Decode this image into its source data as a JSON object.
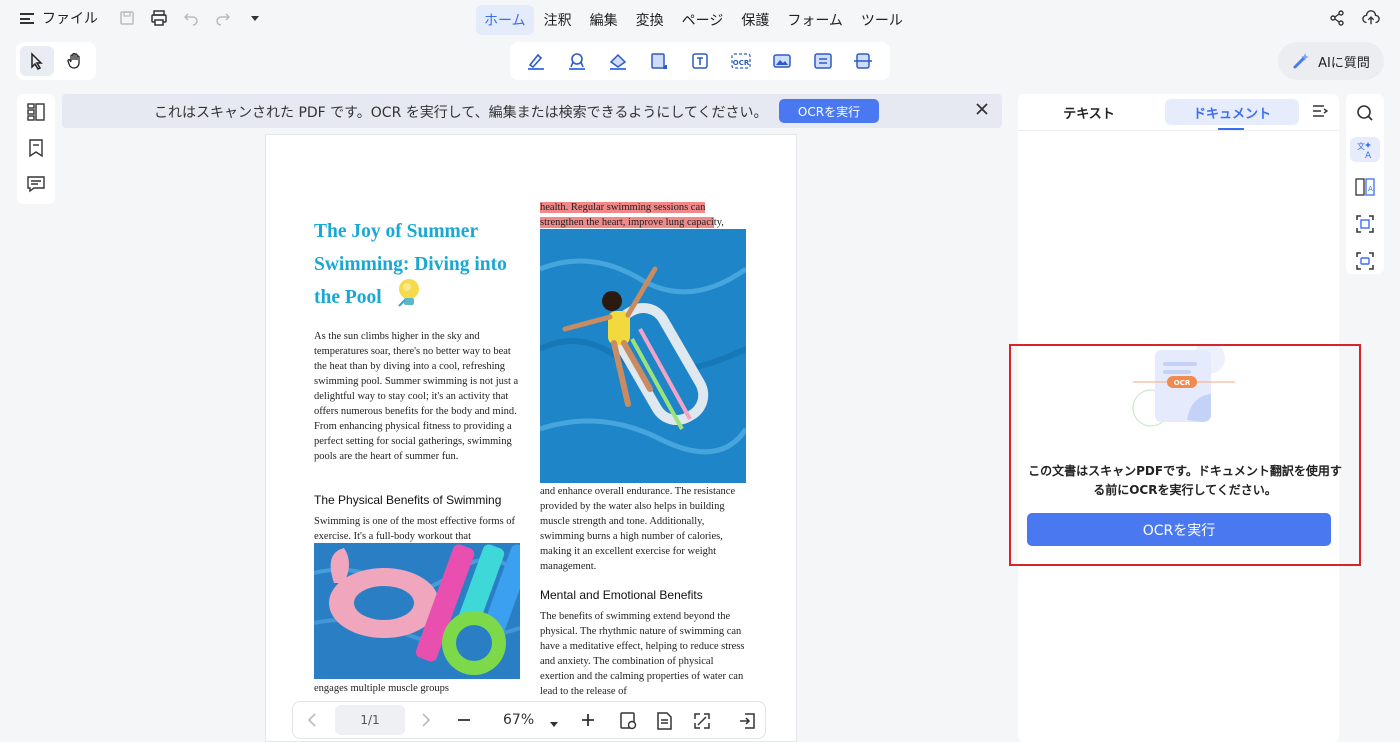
{
  "menu": {
    "file_label": "ファイル",
    "tabs": [
      "ホーム",
      "注釈",
      "編集",
      "変換",
      "ページ",
      "保護",
      "フォーム",
      "ツール"
    ]
  },
  "ai_button": {
    "label": "AIに質問"
  },
  "banner": {
    "text": "これはスキャンされた PDF です。OCR を実行して、編集または検索できるようにしてください。",
    "button_label": "OCRを実行"
  },
  "document": {
    "title": "The Joy of Summer Swimming: Diving into the Pool",
    "intro": "As the sun climbs higher in the sky and temperatures soar, there's no better way to beat the heat than by diving into a cool, refreshing swimming pool. Summer swimming is not just a delightful way to stay cool; it's an activity that offers numerous benefits for the body and mind. From enhancing physical fitness to providing a perfect setting for social gatherings, swimming pools are the heart of summer fun.",
    "section1_heading": "The Physical Benefits of Swimming",
    "section1_text": "Swimming is one of the most effective forms of exercise. It's a full-body workout that",
    "section1_continued": "engages multiple muscle groups",
    "right_highlight_1": "health. Regular swimming sessions can",
    "right_highlight_2": "strengthen the heart, improve lung capaci",
    "right_highlight_2_tail": "ty,",
    "right_continued": "and enhance overall endurance. The resistance provided by the water also helps in building muscle strength and tone. Additionally, swimming burns a high number of calories, making it an excellent exercise for weight management.",
    "section2_heading": "Mental and Emotional Benefits",
    "section2_text": "The benefits of swimming extend beyond the physical. The rhythmic nature of swimming can have a meditative effect, helping to reduce stress and anxiety. The combination of physical exertion and the calming properties of water can lead to the release of"
  },
  "bottom_bar": {
    "page": "1/1",
    "zoom": "67%"
  },
  "right_panel": {
    "tab_text": "テキスト",
    "tab_document": "ドキュメント",
    "ocr_badge": "OCR",
    "message": "この文書はスキャンPDFです。ドキュメント翻訳を使用する前にOCRを実行してください。",
    "run_button": "OCRを実行"
  },
  "colors": {
    "accent": "#4a78f0",
    "title": "#19a8d4",
    "highlight": "#f08a8a",
    "outline": "#d8232a"
  }
}
